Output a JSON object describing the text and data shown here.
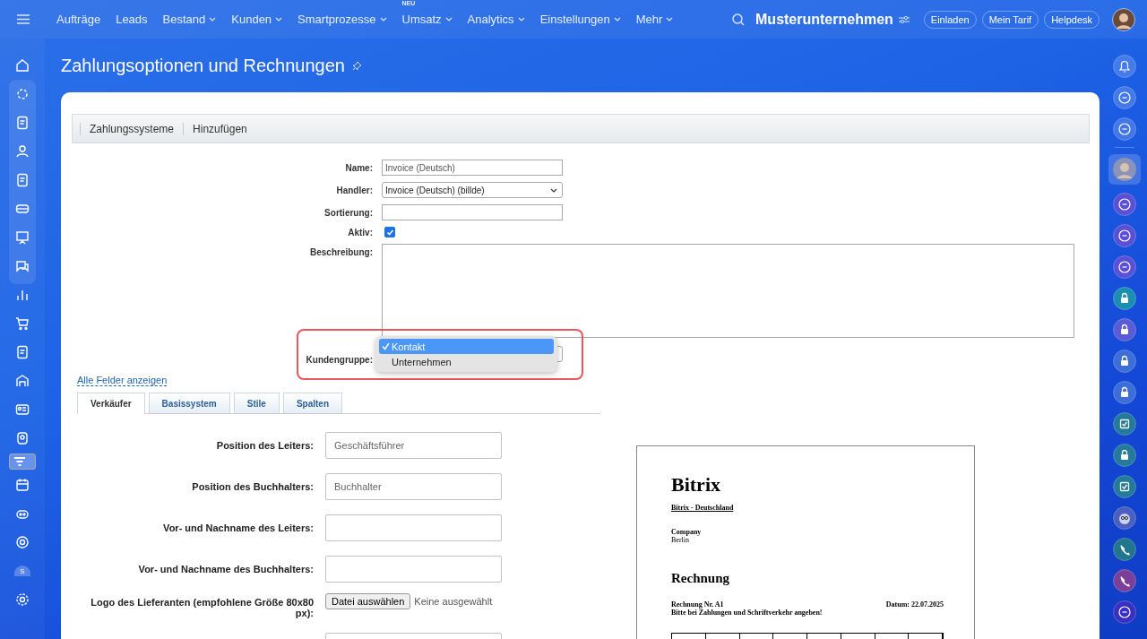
{
  "top_bar": {
    "menu": [
      {
        "label": "Aufträge",
        "has_caret": false
      },
      {
        "label": "Leads",
        "has_caret": false
      },
      {
        "label": "Bestand",
        "has_caret": true
      },
      {
        "label": "Kunden",
        "has_caret": true
      },
      {
        "label": "Smartprozesse",
        "has_caret": true
      },
      {
        "label": "Umsatz",
        "has_caret": true,
        "badge": "NEU"
      },
      {
        "label": "Analytics",
        "has_caret": true
      },
      {
        "label": "Einstellungen",
        "has_caret": true
      },
      {
        "label": "Mehr",
        "has_caret": true
      }
    ],
    "company": "Musterunternehmen",
    "buttons": [
      "Einladen",
      "Mein Tarif",
      "Helpdesk"
    ]
  },
  "left_sidebar": {
    "items": [
      {
        "selected": false
      },
      {
        "selected": false
      },
      {
        "selected": false
      },
      {
        "selected": false
      },
      {
        "selected": false
      },
      {
        "selected": false
      },
      {
        "selected": false
      },
      {
        "selected": false
      },
      {
        "selected": false
      },
      {
        "selected": false
      },
      {
        "selected": false
      },
      {
        "selected": false
      },
      {
        "selected": false
      },
      {
        "selected": false
      },
      {
        "selected": true
      },
      {
        "selected": false
      },
      {
        "selected": false
      },
      {
        "selected": false
      },
      {
        "selected": false,
        "label": "S"
      },
      {
        "selected": false
      }
    ]
  },
  "page": {
    "title": "Zahlungsoptionen und Rechnungen"
  },
  "toolbar": [
    "Zahlungssysteme",
    "Hinzufügen"
  ],
  "form": {
    "name": {
      "label": "Name:",
      "value": "Invoice (Deutsch)"
    },
    "handler": {
      "label": "Handler:",
      "value": "Invoice (Deutsch) (billde)"
    },
    "sort": {
      "label": "Sortierung:"
    },
    "active": {
      "label": "Aktiv:",
      "checked": true
    },
    "description": {
      "label": "Beschreibung:"
    },
    "customer_group": {
      "label": "Kundengruppe:",
      "options": [
        {
          "label": "Kontakt",
          "selected": true
        },
        {
          "label": "Unternehmen",
          "selected": false
        }
      ]
    }
  },
  "show_all_link": "Alle Felder anzeigen",
  "tabs": [
    {
      "label": "Verkäufer",
      "selected": true
    },
    {
      "label": "Basissystem",
      "selected": false
    },
    {
      "label": "Stile",
      "selected": false
    },
    {
      "label": "Spalten",
      "selected": false
    }
  ],
  "seller_fields": [
    {
      "kind": "text",
      "label": "Position des Leiters:",
      "placeholder": "Geschäftsführer"
    },
    {
      "kind": "text",
      "label": "Position des Buchhalters:",
      "placeholder": "Buchhalter"
    },
    {
      "kind": "text",
      "label": "Vor- und Nachname des Leiters:"
    },
    {
      "kind": "text",
      "label": "Vor- und Nachname des Buchhalters:"
    },
    {
      "kind": "file",
      "label": "Logo des Lieferanten (empfohlene Größe 80x80 px):",
      "button": "Datei auswählen",
      "status": "Keine ausgewählt"
    },
    {
      "kind": "text"
    }
  ],
  "invoice_preview": {
    "company": "Bitrix",
    "subtitle": "Bitrix - Deutschland",
    "recipient": "Company",
    "city": "Berlin",
    "heading": "Rechnung",
    "number": "Rechnung Nr. A1",
    "date": "Datum: 22.07.2025",
    "note": "Bitte bei Zahlungen und Schriftverkehr angeben!"
  }
}
